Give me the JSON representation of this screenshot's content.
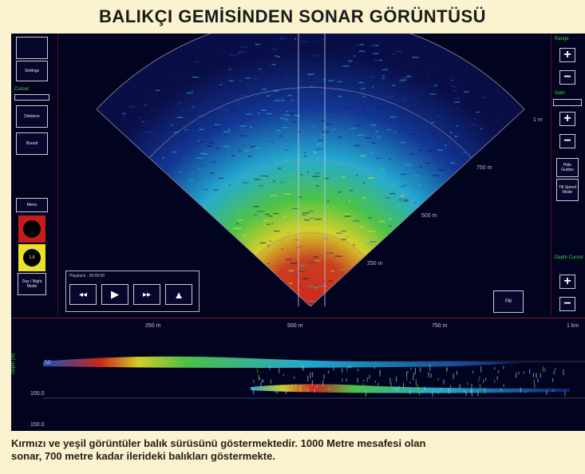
{
  "page_title": "BALIKÇI GEMİSİNDEN SONAR GÖRÜNTÜSÜ",
  "caption": {
    "line1": "Kırmızı ve yeşil görüntüler balık sürüsünü göstermektedir. 1000 Metre mesafesi olan",
    "line2": "sonar, 700 metre kadar ilerideki balıkları göstermekte."
  },
  "sonar": {
    "left_panel": {
      "settings_label": "Settings",
      "cursor_label": "Cursor",
      "distance_label": "Distance",
      "bound_label": "Bound",
      "menu_label": "Menu",
      "dial_label": "1.0",
      "day_night_label": "Day / Night Mode"
    },
    "right_panel": {
      "range_label": "Range",
      "gain_label": "Gain",
      "depth_label": "Depth Cursor",
      "fill_label": "Fill",
      "plus": "+",
      "minus": "−",
      "option1": "Hide Guides",
      "option2": "Tilt Speed Mode"
    },
    "range_labels": [
      "750 m",
      "500 m",
      "250 m"
    ],
    "edge_label": "1 m",
    "player": {
      "label": "Playback · 00:00:00",
      "rewind": "◂◂",
      "play": "▶",
      "forward": "▸▸",
      "eject": "▲"
    },
    "echogram": {
      "x_ticks": [
        "250 m",
        "500 m",
        "750 m",
        "1 km"
      ],
      "depths": [
        "50",
        "100.0",
        "150.0"
      ],
      "axis_label": "Depth (m)"
    }
  },
  "colors": {
    "background": "#fbf3cf",
    "screen": "#02031e",
    "accent_green": "#3fd74a",
    "echo_red": "#e02a1c",
    "echo_yellow": "#e7e22a",
    "echo_cyan": "#27b9e0"
  }
}
